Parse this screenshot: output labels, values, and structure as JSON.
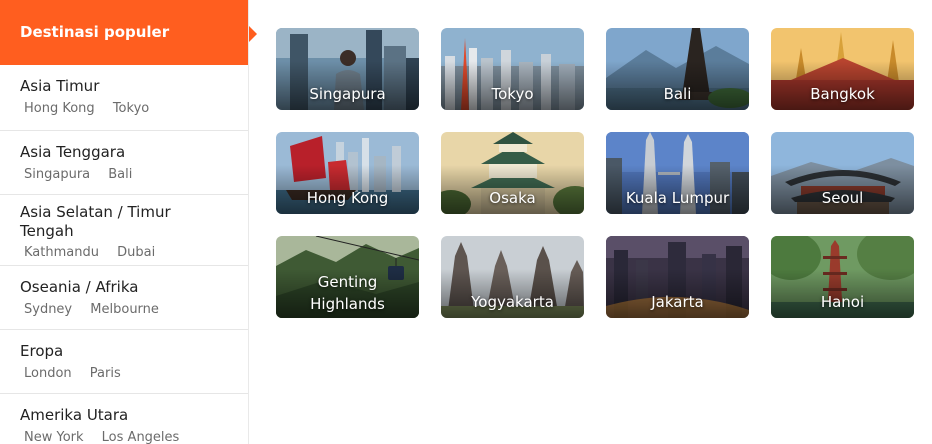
{
  "sidebar": {
    "header": "Destinasi populer",
    "regions": [
      {
        "title": "Asia Timur",
        "cities": [
          "Hong Kong",
          "Tokyo"
        ]
      },
      {
        "title": "Asia Tenggara",
        "cities": [
          "Singapura",
          "Bali"
        ]
      },
      {
        "title": "Asia Selatan / Timur Tengah",
        "cities": [
          "Kathmandu",
          "Dubai"
        ]
      },
      {
        "title": "Oseania / Afrika",
        "cities": [
          "Sydney",
          "Melbourne"
        ]
      },
      {
        "title": "Eropa",
        "cities": [
          "London",
          "Paris"
        ]
      },
      {
        "title": "Amerika Utara",
        "cities": [
          "New York",
          "Los Angeles"
        ]
      }
    ]
  },
  "destinations": [
    {
      "label": "Singapura",
      "icon": "singapore-image"
    },
    {
      "label": "Tokyo",
      "icon": "tokyo-image"
    },
    {
      "label": "Bali",
      "icon": "bali-image"
    },
    {
      "label": "Bangkok",
      "icon": "bangkok-image"
    },
    {
      "label": "Hong Kong",
      "icon": "hong-kong-image"
    },
    {
      "label": "Osaka",
      "icon": "osaka-image"
    },
    {
      "label": "Kuala Lumpur",
      "icon": "kuala-lumpur-image"
    },
    {
      "label": "Seoul",
      "icon": "seoul-image"
    },
    {
      "label": "Genting Highlands",
      "icon": "genting-highlands-image"
    },
    {
      "label": "Yogyakarta",
      "icon": "yogyakarta-image"
    },
    {
      "label": "Jakarta",
      "icon": "jakarta-image"
    },
    {
      "label": "Hanoi",
      "icon": "hanoi-image"
    }
  ],
  "colors": {
    "accent": "#ff5e1f"
  }
}
